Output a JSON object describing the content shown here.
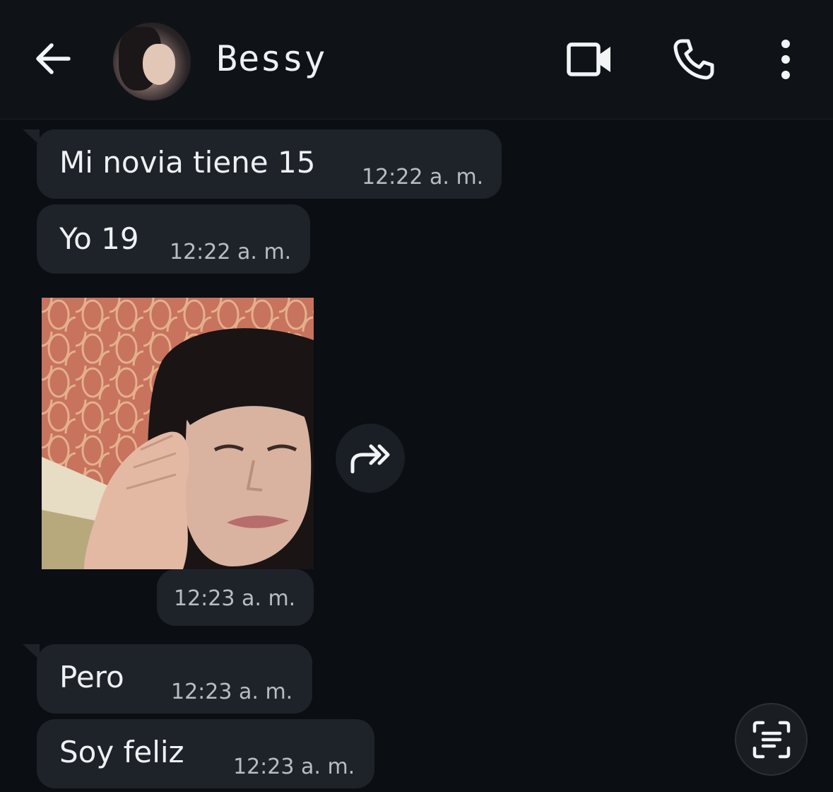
{
  "header": {
    "contact_name": "Bessy",
    "back_icon": "arrow-left-icon",
    "video_icon": "video-camera-icon",
    "call_icon": "phone-icon",
    "menu_icon": "more-vertical-icon"
  },
  "messages": [
    {
      "type": "text",
      "text": "Mi novia tiene 15",
      "time": "12:22 a. m."
    },
    {
      "type": "text",
      "text": "Yo 19",
      "time": "12:22 a. m."
    },
    {
      "type": "image",
      "time": "12:23 a. m."
    },
    {
      "type": "text",
      "text": "Pero",
      "time": "12:23 a. m."
    },
    {
      "type": "text",
      "text": "Soy feliz",
      "time": "12:23 a. m."
    }
  ],
  "actions": {
    "forward_icon": "forward-icon",
    "scan_icon": "text-scan-icon"
  },
  "colors": {
    "background": "#0b0e13",
    "bubble": "#1e2329",
    "text": "#eef1f3",
    "time": "#b8bdc2"
  }
}
